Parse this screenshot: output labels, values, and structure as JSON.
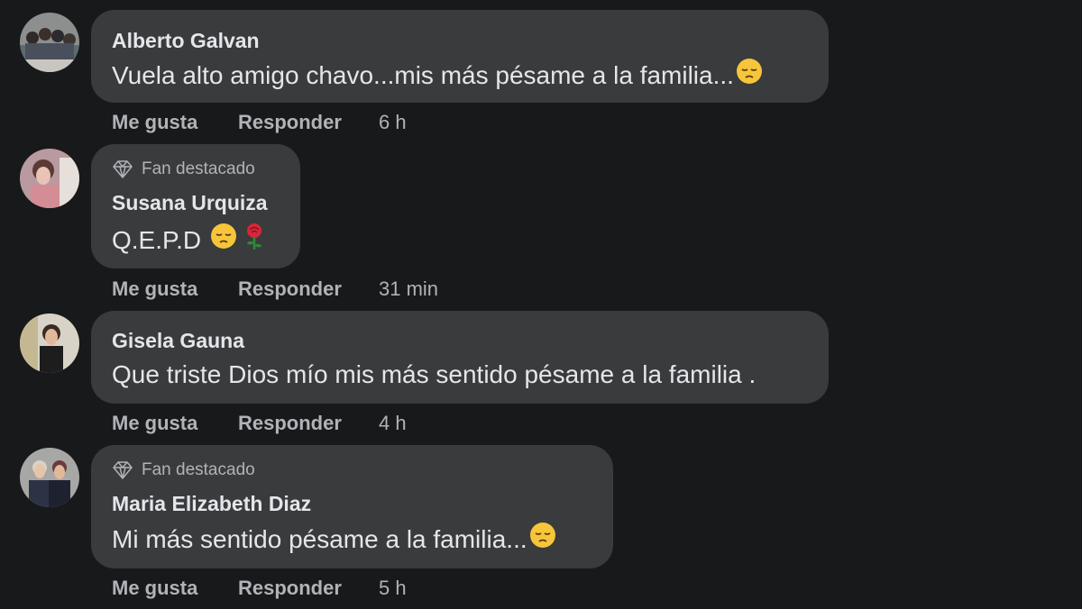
{
  "comments": [
    {
      "author": "Alberto Galvan",
      "badge": "",
      "text": "Vuela alto amigo chavo...mis más pésame a la familia...",
      "emojis": [
        "pensive-face-emoji"
      ],
      "like_label": "Me gusta",
      "reply_label": "Responder",
      "time": "6 h"
    },
    {
      "author": "Susana Urquiza",
      "badge": "Fan destacado",
      "text": "Q.E.P.D",
      "emojis": [
        "pensive-face-emoji",
        "rose-emoji"
      ],
      "like_label": "Me gusta",
      "reply_label": "Responder",
      "time": "31 min"
    },
    {
      "author": "Gisela Gauna",
      "badge": "",
      "text": "Que triste Dios mío mis más sentido pésame a la familia .",
      "emojis": [],
      "like_label": "Me gusta",
      "reply_label": "Responder",
      "time": "4 h"
    },
    {
      "author": "Maria Elizabeth Diaz",
      "badge": "Fan destacado",
      "text": "Mi más sentido pésame a la familia...",
      "emojis": [
        "pensive-face-emoji"
      ],
      "like_label": "Me gusta",
      "reply_label": "Responder",
      "time": "5 h"
    }
  ],
  "colors": {
    "background": "#18191a",
    "bubble": "#3a3b3c",
    "primary_text": "#e4e6eb",
    "secondary_text": "#b0b3b8"
  }
}
